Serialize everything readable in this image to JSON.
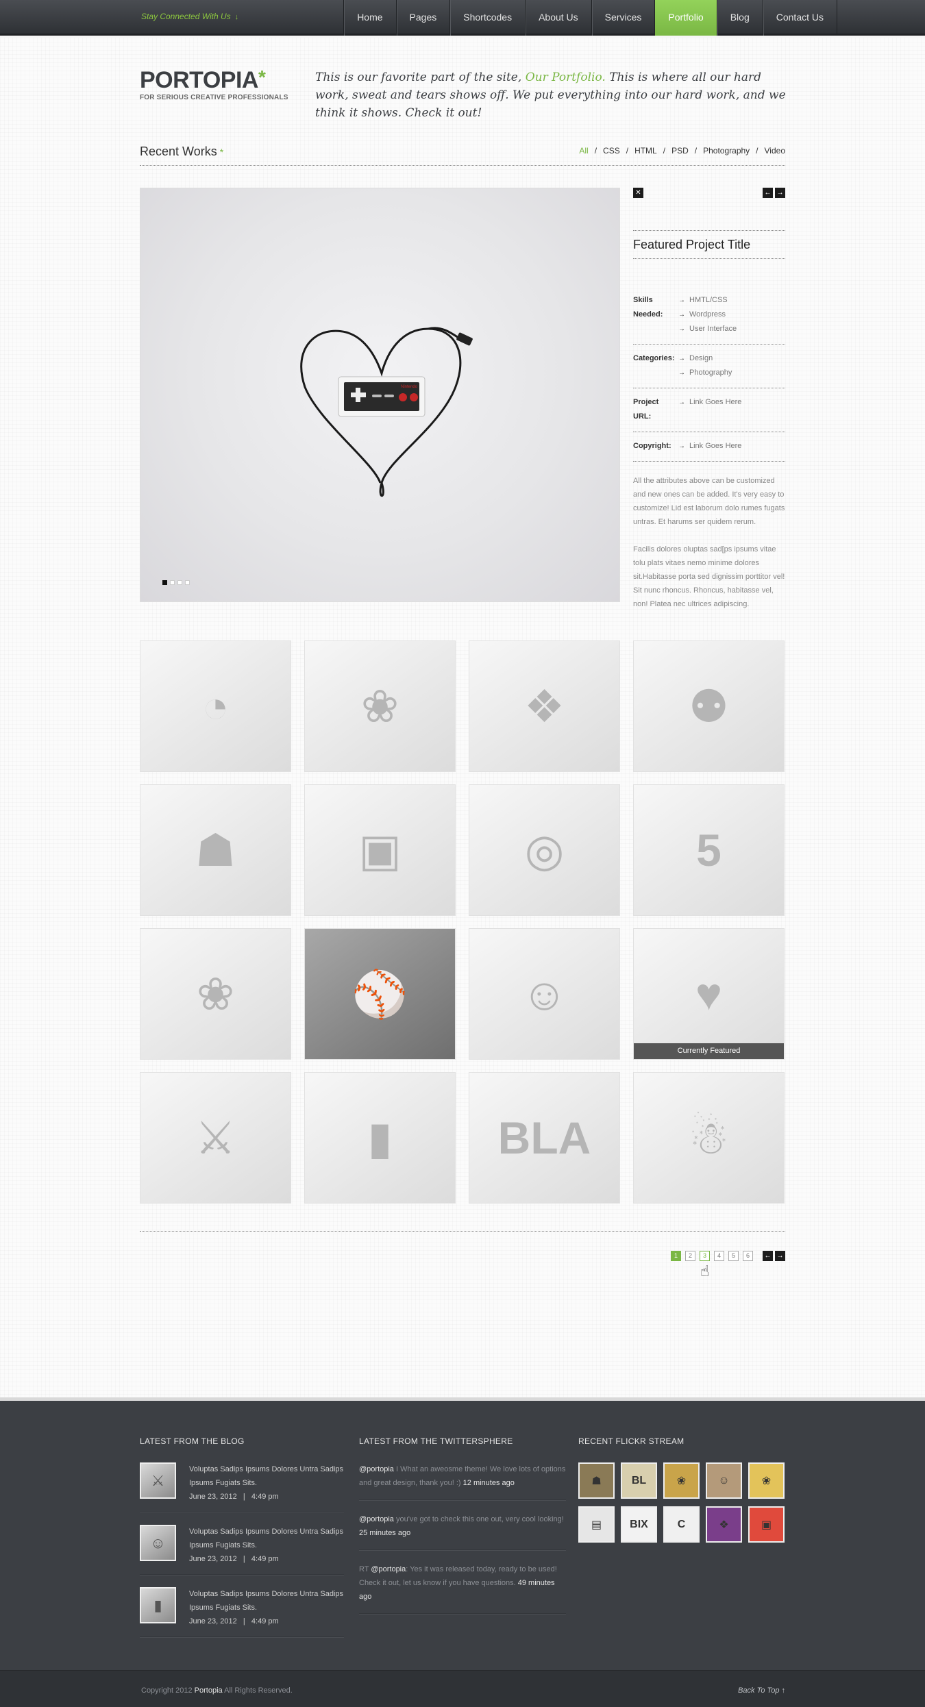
{
  "topbar": {
    "stay_connected": "Stay Connected With Us",
    "stay_arrow": "↓",
    "nav": [
      "Home",
      "Pages",
      "Shortcodes",
      "About Us",
      "Services",
      "Portfolio",
      "Blog",
      "Contact Us"
    ],
    "active_nav": "Portfolio"
  },
  "logo": {
    "name": "PORTOPIA",
    "star": "*",
    "tagline": "FOR SERIOUS CREATIVE PROFESSIONALS"
  },
  "intro": {
    "before": "This is our favorite part of the site, ",
    "highlight": "Our Portfolio.",
    "after": " This is where all our hard work, sweat and tears shows off.  We put everything into our hard work, and we think it shows.  Check it out!"
  },
  "recent_works": {
    "title": "Recent Works",
    "star": "*",
    "filters": [
      "All",
      "CSS",
      "HTML",
      "PSD",
      "Photography",
      "Video"
    ],
    "active_filter": "All",
    "separator": "/"
  },
  "featured": {
    "close_icon": "✕",
    "prev_icon": "←",
    "next_icon": "→",
    "title": "Featured Project Title",
    "skills_label": "Skills Needed:",
    "skills": [
      "HMTL/CSS",
      "Wordpress",
      "User Interface"
    ],
    "categories_label": "Categories:",
    "categories": [
      "Design",
      "Photography"
    ],
    "url_label": "Project URL:",
    "url_value": "Link Goes Here",
    "copyright_label": "Copyright:",
    "copyright_value": "Link Goes Here",
    "desc1": "All the attributes above can be customized and new ones can be added.  It's very easy to customize!   Lid est laborum dolo rumes fugats untras. Et harums ser quidem rerum.",
    "desc2": "Facilis dolores oluptas sad[ps ipsums vitae tolu plats vitaes nemo minime dolores sit.Habitasse porta sed dignissim porttitor vel! Sit nunc rhoncus. Rhoncus, habitasse vel, non! Platea nec ultrices adipiscing.",
    "slider_dots": 4,
    "active_dot": 1
  },
  "portfolio": {
    "tiles": [
      {
        "icon": "◔",
        "dark": false
      },
      {
        "icon": "❀",
        "dark": false
      },
      {
        "icon": "❖",
        "dark": false
      },
      {
        "icon": "⚉",
        "dark": false
      },
      {
        "icon": "☗",
        "dark": false
      },
      {
        "icon": "▣",
        "dark": false
      },
      {
        "icon": "◎",
        "dark": false
      },
      {
        "icon": "5",
        "dark": false
      },
      {
        "icon": "❀",
        "dark": false
      },
      {
        "icon": "⚾",
        "dark": true
      },
      {
        "icon": "☺",
        "dark": false
      },
      {
        "icon": "♥",
        "dark": false
      },
      {
        "icon": "⚔",
        "dark": false
      },
      {
        "icon": "▮",
        "dark": false
      },
      {
        "icon": "BLA",
        "dark": false
      },
      {
        "icon": "☃",
        "dark": false
      }
    ],
    "featured_index": 11,
    "featured_caption": "Currently Featured"
  },
  "pagination": {
    "pages": [
      "1",
      "2",
      "3",
      "4",
      "5",
      "6"
    ],
    "active": "1",
    "hover": "3",
    "prev_icon": "←",
    "next_icon": "→"
  },
  "footer": {
    "blog": {
      "heading": "LATEST FROM THE BLOG",
      "posts": [
        {
          "title": "Voluptas Sadips Ipsums Dolores Untra Sadips Ipsums Fugiats Sits.",
          "date": "June 23, 2012   |   4:49 pm",
          "icon": "⚔"
        },
        {
          "title": "Voluptas Sadips Ipsums Dolores Untra Sadips Ipsums Fugiats Sits.",
          "date": "June 23, 2012   |   4:49 pm",
          "icon": "☺"
        },
        {
          "title": "Voluptas Sadips Ipsums Dolores Untra Sadips Ipsums Fugiats Sits.",
          "date": "June 23, 2012   |   4:49 pm",
          "icon": "▮"
        }
      ]
    },
    "twitter": {
      "heading": "LATEST FROM THE TWITTERSPHERE",
      "tweets": [
        {
          "prefix": "",
          "handle": "@portopia",
          "text": " I What an aweosme theme!  We love lots of options and great design, thank you!  :) ",
          "time": "12 minutes ago"
        },
        {
          "prefix": "",
          "handle": "@portopia",
          "text": " you've got to check this one out, very cool looking! ",
          "time": "25 minutes ago"
        },
        {
          "prefix": "RT ",
          "handle": "@portopia",
          "text": ": Yes it was released today, ready to be used! Check it out, let us know if you have questions. ",
          "time": "49 minutes ago"
        }
      ]
    },
    "flickr": {
      "heading": "RECENT FLICKR STREAM",
      "items": [
        {
          "icon": "☗",
          "color": "#8a7a56"
        },
        {
          "icon": "BL",
          "color": "#d8cfae"
        },
        {
          "icon": "❀",
          "color": "#c9a44a"
        },
        {
          "icon": "☺",
          "color": "#b49a7a"
        },
        {
          "icon": "❀",
          "color": "#e3c35a"
        },
        {
          "icon": "▤",
          "color": "#e6e6e6"
        },
        {
          "icon": "BIX",
          "color": "#f2f2f2"
        },
        {
          "icon": "C",
          "color": "#f0f0f0"
        },
        {
          "icon": "❖",
          "color": "#7a3e8a"
        },
        {
          "icon": "▣",
          "color": "#e04a3c"
        }
      ]
    },
    "copyright_before": "Copyright 2012 ",
    "copyright_brand": "Portopia",
    "copyright_after": "  All Rights Reserved.",
    "back_to_top": "Back To Top  ↑"
  },
  "colors": {
    "accent": "#7ab744",
    "topbar": "#3a3d42",
    "footer": "#3c3f44"
  }
}
